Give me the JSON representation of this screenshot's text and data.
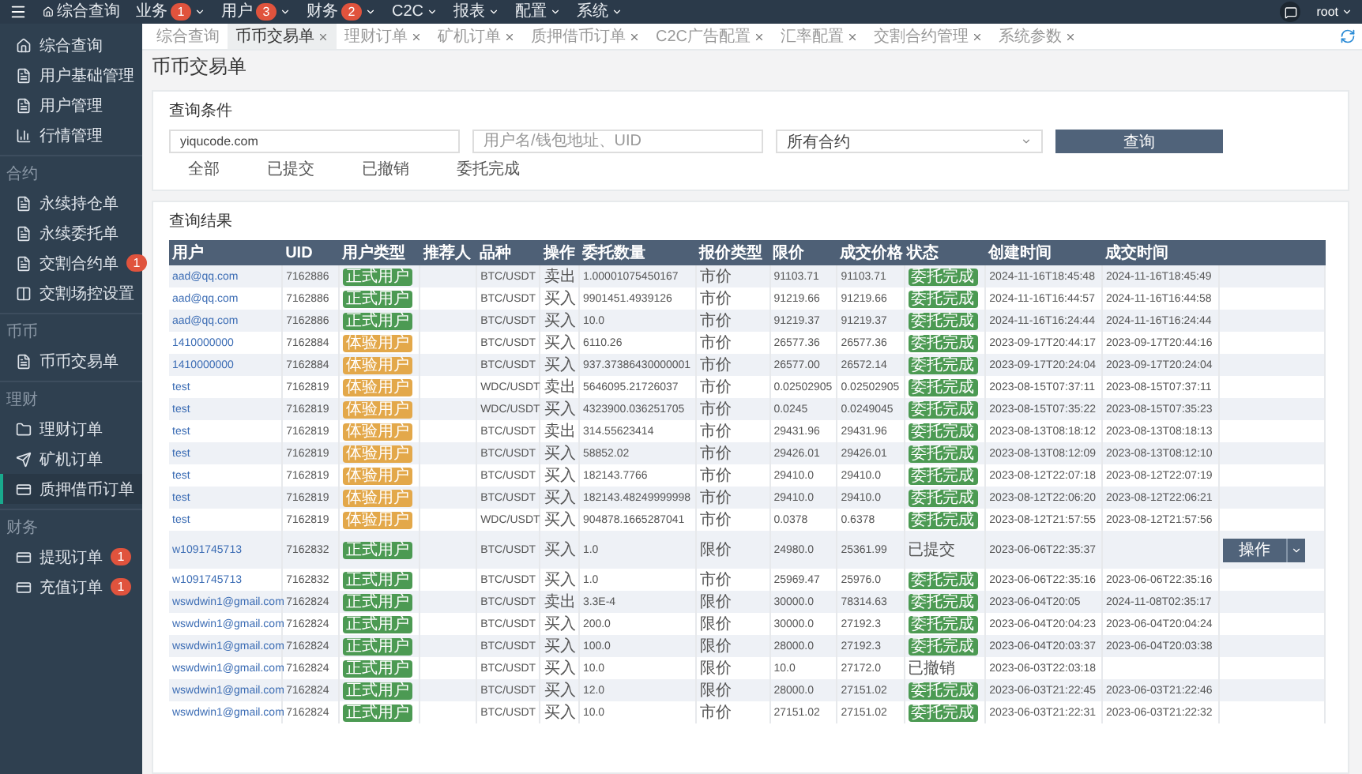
{
  "topbar": {
    "menu": [
      {
        "label": "综合查询",
        "kind": "home"
      },
      {
        "label": "业务",
        "badge": "1",
        "kind": "dropdown"
      },
      {
        "label": "用户",
        "badge": "3",
        "kind": "dropdown"
      },
      {
        "label": "财务",
        "badge": "2",
        "kind": "dropdown"
      },
      {
        "label": "C2C",
        "kind": "dropdown"
      },
      {
        "label": "报表",
        "kind": "dropdown"
      },
      {
        "label": "配置",
        "kind": "dropdown"
      },
      {
        "label": "系统",
        "kind": "dropdown"
      }
    ],
    "user": "root"
  },
  "sidebar": {
    "sections": [
      {
        "items": [
          {
            "label": "综合查询",
            "kind": "home",
            "selected": false
          },
          {
            "label": "用户基础管理",
            "kind": "doc",
            "selected": false
          },
          {
            "label": "用户管理",
            "kind": "doc",
            "selected": false
          },
          {
            "label": "行情管理",
            "kind": "chart",
            "selected": false
          }
        ]
      },
      {
        "title": "合约",
        "items": [
          {
            "label": "永续持仓单",
            "kind": "doc",
            "selected": false
          },
          {
            "label": "永续委托单",
            "kind": "doc",
            "selected": false
          },
          {
            "label": "交割合约单",
            "kind": "doc",
            "badge": "1",
            "selected": false
          },
          {
            "label": "交割场控设置",
            "kind": "columns",
            "selected": false
          }
        ]
      },
      {
        "title": "币币",
        "items": [
          {
            "label": "币币交易单",
            "kind": "doc",
            "selected": false
          }
        ]
      },
      {
        "title": "理财",
        "items": [
          {
            "label": "理财订单",
            "kind": "folder",
            "selected": false
          },
          {
            "label": "矿机订单",
            "kind": "send",
            "selected": false
          },
          {
            "label": "质押借币订单",
            "kind": "card",
            "selected": true
          }
        ]
      },
      {
        "title": "财务",
        "items": [
          {
            "label": "提现订单",
            "kind": "card",
            "badge": "1",
            "selected": false
          },
          {
            "label": "充值订单",
            "kind": "card",
            "badge": "1",
            "selected": false
          }
        ]
      }
    ]
  },
  "tabs": [
    {
      "label": "综合查询",
      "closable": false,
      "selected": false
    },
    {
      "label": "币币交易单",
      "closable": true,
      "selected": true
    },
    {
      "label": "理财订单",
      "closable": true,
      "selected": false
    },
    {
      "label": "矿机订单",
      "closable": true,
      "selected": false
    },
    {
      "label": "质押借币订单",
      "closable": true,
      "selected": false
    },
    {
      "label": "C2C广告配置",
      "closable": true,
      "selected": false
    },
    {
      "label": "汇率配置",
      "closable": true,
      "selected": false
    },
    {
      "label": "交割合约管理",
      "closable": true,
      "selected": false
    },
    {
      "label": "系统参数",
      "closable": true,
      "selected": false
    }
  ],
  "page_title": "币币交易单",
  "query": {
    "title": "查询条件",
    "keyword": "yiqucode.com",
    "user_placeholder": "用户名/钱包地址、UID",
    "contract": "所有合约",
    "button": "查询",
    "filters": [
      "全部",
      "已提交",
      "已撤销",
      "委托完成"
    ]
  },
  "results": {
    "title": "查询结果",
    "columns": [
      "用户",
      "UID",
      "用户类型",
      "推荐人",
      "品种",
      "操作",
      "委托数量",
      "报价类型",
      "限价",
      "成交价格",
      "状态",
      "创建时间",
      "成交时间"
    ],
    "rows": [
      {
        "user": "aad@qq.com",
        "uid": "7162886",
        "type": {
          "label": "正式用户",
          "kind": "formal"
        },
        "pair": "BTC/USDT",
        "side": "卖出",
        "qty": "1.00001075450167",
        "price_type": "市价",
        "limit": "91103.71",
        "deal": "91103.71",
        "status": {
          "label": "委托完成",
          "kind": "done"
        },
        "created": "2024-11-16T18:45:48",
        "filled": "2024-11-16T18:45:49"
      },
      {
        "user": "aad@qq.com",
        "uid": "7162886",
        "type": {
          "label": "正式用户",
          "kind": "formal"
        },
        "pair": "BTC/USDT",
        "side": "买入",
        "qty": "9901451.4939126",
        "price_type": "市价",
        "limit": "91219.66",
        "deal": "91219.66",
        "status": {
          "label": "委托完成",
          "kind": "done"
        },
        "created": "2024-11-16T16:44:57",
        "filled": "2024-11-16T16:44:58"
      },
      {
        "user": "aad@qq.com",
        "uid": "7162886",
        "type": {
          "label": "正式用户",
          "kind": "formal"
        },
        "pair": "BTC/USDT",
        "side": "买入",
        "qty": "10.0",
        "price_type": "市价",
        "limit": "91219.37",
        "deal": "91219.37",
        "status": {
          "label": "委托完成",
          "kind": "done"
        },
        "created": "2024-11-16T16:24:44",
        "filled": "2024-11-16T16:24:44"
      },
      {
        "user": "1410000000",
        "uid": "7162884",
        "type": {
          "label": "体验用户",
          "kind": "trial"
        },
        "pair": "BTC/USDT",
        "side": "买入",
        "qty": "6110.26",
        "price_type": "市价",
        "limit": "26577.36",
        "deal": "26577.36",
        "status": {
          "label": "委托完成",
          "kind": "done"
        },
        "created": "2023-09-17T20:44:17",
        "filled": "2023-09-17T20:44:16"
      },
      {
        "user": "1410000000",
        "uid": "7162884",
        "type": {
          "label": "体验用户",
          "kind": "trial"
        },
        "pair": "BTC/USDT",
        "side": "买入",
        "qty": "937.37386430000001",
        "price_type": "市价",
        "limit": "26577.00",
        "deal": "26572.14",
        "status": {
          "label": "委托完成",
          "kind": "done"
        },
        "created": "2023-09-17T20:24:04",
        "filled": "2023-09-17T20:24:04"
      },
      {
        "user": "test",
        "uid": "7162819",
        "type": {
          "label": "体验用户",
          "kind": "trial"
        },
        "pair": "WDC/USDT",
        "side": "卖出",
        "qty": "5646095.21726037",
        "price_type": "市价",
        "limit": "0.02502905",
        "deal": "0.02502905",
        "status": {
          "label": "委托完成",
          "kind": "done"
        },
        "created": "2023-08-15T07:37:11",
        "filled": "2023-08-15T07:37:11"
      },
      {
        "user": "test",
        "uid": "7162819",
        "type": {
          "label": "体验用户",
          "kind": "trial"
        },
        "pair": "WDC/USDT",
        "side": "买入",
        "qty": "4323900.036251705",
        "price_type": "市价",
        "limit": "0.0245",
        "deal": "0.0249045",
        "status": {
          "label": "委托完成",
          "kind": "done"
        },
        "created": "2023-08-15T07:35:22",
        "filled": "2023-08-15T07:35:23"
      },
      {
        "user": "test",
        "uid": "7162819",
        "type": {
          "label": "体验用户",
          "kind": "trial"
        },
        "pair": "BTC/USDT",
        "side": "卖出",
        "qty": "314.55623414",
        "price_type": "市价",
        "limit": "29431.96",
        "deal": "29431.96",
        "status": {
          "label": "委托完成",
          "kind": "done"
        },
        "created": "2023-08-13T08:18:12",
        "filled": "2023-08-13T08:18:13"
      },
      {
        "user": "test",
        "uid": "7162819",
        "type": {
          "label": "体验用户",
          "kind": "trial"
        },
        "pair": "BTC/USDT",
        "side": "买入",
        "qty": "58852.02",
        "price_type": "市价",
        "limit": "29426.01",
        "deal": "29426.01",
        "status": {
          "label": "委托完成",
          "kind": "done"
        },
        "created": "2023-08-13T08:12:09",
        "filled": "2023-08-13T08:12:10"
      },
      {
        "user": "test",
        "uid": "7162819",
        "type": {
          "label": "体验用户",
          "kind": "trial"
        },
        "pair": "BTC/USDT",
        "side": "买入",
        "qty": "182143.7766",
        "price_type": "市价",
        "limit": "29410.0",
        "deal": "29410.0",
        "status": {
          "label": "委托完成",
          "kind": "done"
        },
        "created": "2023-08-12T22:07:18",
        "filled": "2023-08-12T22:07:19"
      },
      {
        "user": "test",
        "uid": "7162819",
        "type": {
          "label": "体验用户",
          "kind": "trial"
        },
        "pair": "BTC/USDT",
        "side": "买入",
        "qty": "182143.48249999998",
        "price_type": "市价",
        "limit": "29410.0",
        "deal": "29410.0",
        "status": {
          "label": "委托完成",
          "kind": "done"
        },
        "created": "2023-08-12T22:06:20",
        "filled": "2023-08-12T22:06:21"
      },
      {
        "user": "test",
        "uid": "7162819",
        "type": {
          "label": "体验用户",
          "kind": "trial"
        },
        "pair": "WDC/USDT",
        "side": "买入",
        "qty": "904878.1665287041",
        "price_type": "市价",
        "limit": "0.0378",
        "deal": "0.6378",
        "status": {
          "label": "委托完成",
          "kind": "done"
        },
        "created": "2023-08-12T21:57:55",
        "filled": "2023-08-12T21:57:56"
      },
      {
        "user": "w1091745713",
        "uid": "7162832",
        "type": {
          "label": "正式用户",
          "kind": "formal"
        },
        "pair": "BTC/USDT",
        "side": "买入",
        "qty": "1.0",
        "price_type": "限价",
        "limit": "24980.0",
        "deal": "25361.99",
        "status": {
          "label": "已提交",
          "kind": "text"
        },
        "created": "2023-06-06T22:35:37",
        "action": "操作"
      },
      {
        "user": "w1091745713",
        "uid": "7162832",
        "type": {
          "label": "正式用户",
          "kind": "formal"
        },
        "pair": "BTC/USDT",
        "side": "买入",
        "qty": "1.0",
        "price_type": "市价",
        "limit": "25969.47",
        "deal": "25976.0",
        "status": {
          "label": "委托完成",
          "kind": "done"
        },
        "created": "2023-06-06T22:35:16",
        "filled": "2023-06-06T22:35:16"
      },
      {
        "user": "wswdwin1@gmail.com",
        "uid": "7162824",
        "type": {
          "label": "正式用户",
          "kind": "formal"
        },
        "pair": "BTC/USDT",
        "side": "卖出",
        "qty": "3.3E-4",
        "price_type": "限价",
        "limit": "30000.0",
        "deal": "78314.63",
        "status": {
          "label": "委托完成",
          "kind": "done"
        },
        "created": "2023-06-04T20:05",
        "filled": "2024-11-08T02:35:17"
      },
      {
        "user": "wswdwin1@gmail.com",
        "uid": "7162824",
        "type": {
          "label": "正式用户",
          "kind": "formal"
        },
        "pair": "BTC/USDT",
        "side": "买入",
        "qty": "200.0",
        "price_type": "限价",
        "limit": "30000.0",
        "deal": "27192.3",
        "status": {
          "label": "委托完成",
          "kind": "done"
        },
        "created": "2023-06-04T20:04:23",
        "filled": "2023-06-04T20:04:24"
      },
      {
        "user": "wswdwin1@gmail.com",
        "uid": "7162824",
        "type": {
          "label": "正式用户",
          "kind": "formal"
        },
        "pair": "BTC/USDT",
        "side": "买入",
        "qty": "100.0",
        "price_type": "限价",
        "limit": "28000.0",
        "deal": "27192.3",
        "status": {
          "label": "委托完成",
          "kind": "done"
        },
        "created": "2023-06-04T20:03:37",
        "filled": "2023-06-04T20:03:38"
      },
      {
        "user": "wswdwin1@gmail.com",
        "uid": "7162824",
        "type": {
          "label": "正式用户",
          "kind": "formal"
        },
        "pair": "BTC/USDT",
        "side": "买入",
        "qty": "10.0",
        "price_type": "限价",
        "limit": "10.0",
        "deal": "27172.0",
        "status": {
          "label": "已撤销",
          "kind": "text"
        },
        "created": "2023-06-03T22:03:18"
      },
      {
        "user": "wswdwin1@gmail.com",
        "uid": "7162824",
        "type": {
          "label": "正式用户",
          "kind": "formal"
        },
        "pair": "BTC/USDT",
        "side": "买入",
        "qty": "12.0",
        "price_type": "限价",
        "limit": "28000.0",
        "deal": "27151.02",
        "status": {
          "label": "委托完成",
          "kind": "done"
        },
        "created": "2023-06-03T21:22:45",
        "filled": "2023-06-03T21:22:46"
      },
      {
        "user": "wswdwin1@gmail.com",
        "uid": "7162824",
        "type": {
          "label": "正式用户",
          "kind": "formal"
        },
        "pair": "BTC/USDT",
        "side": "买入",
        "qty": "10.0",
        "price_type": "市价",
        "limit": "27151.02",
        "deal": "27151.02",
        "status": {
          "label": "委托完成",
          "kind": "done"
        },
        "created": "2023-06-03T21:22:31",
        "filled": "2023-06-03T21:22:32"
      }
    ]
  }
}
